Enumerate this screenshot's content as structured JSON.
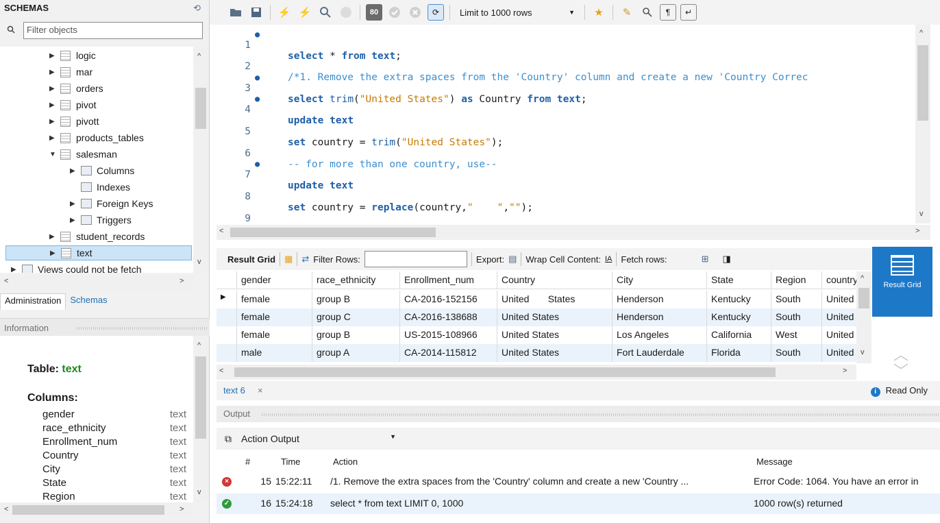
{
  "sidebar": {
    "title": "SCHEMAS",
    "filter_placeholder": "Filter objects",
    "tree": [
      {
        "label": "logic",
        "kind": "table",
        "indent": 1,
        "expanded": false
      },
      {
        "label": "mar",
        "kind": "table",
        "indent": 1,
        "expanded": false
      },
      {
        "label": "orders",
        "kind": "table",
        "indent": 1,
        "expanded": false
      },
      {
        "label": "pivot",
        "kind": "table",
        "indent": 1,
        "expanded": false
      },
      {
        "label": "pivott",
        "kind": "table",
        "indent": 1,
        "expanded": false
      },
      {
        "label": "products_tables",
        "kind": "table",
        "indent": 1,
        "expanded": false
      },
      {
        "label": "salesman",
        "kind": "table",
        "indent": 1,
        "expanded": true
      },
      {
        "label": "Columns",
        "kind": "sub",
        "indent": 2,
        "expanded": false
      },
      {
        "label": "Indexes",
        "kind": "sub",
        "indent": 2,
        "expanded": null
      },
      {
        "label": "Foreign Keys",
        "kind": "sub",
        "indent": 2,
        "expanded": false
      },
      {
        "label": "Triggers",
        "kind": "sub",
        "indent": 2,
        "expanded": false
      },
      {
        "label": "student_records",
        "kind": "table",
        "indent": 1,
        "expanded": false
      },
      {
        "label": "text",
        "kind": "table",
        "indent": 1,
        "expanded": false,
        "selected": true
      },
      {
        "label": "Views could not be fetch",
        "kind": "sub",
        "indent": 0,
        "expanded": false
      }
    ],
    "tabs": {
      "administration": "Administration",
      "schemas": "Schemas"
    },
    "info_title": "Information",
    "info": {
      "table_label": "Table:",
      "table_name": "text",
      "columns_label": "Columns:",
      "columns": [
        {
          "name": "gender",
          "type": "text"
        },
        {
          "name": "race_ethnicity",
          "type": "text"
        },
        {
          "name": "Enrollment_num",
          "type": "text"
        },
        {
          "name": "Country",
          "type": "text"
        },
        {
          "name": "City",
          "type": "text"
        },
        {
          "name": "State",
          "type": "text"
        },
        {
          "name": "Region",
          "type": "text"
        }
      ]
    }
  },
  "toolbar": {
    "limit_label": "Limit to 1000 rows"
  },
  "editor": {
    "lines": [
      {
        "n": "1",
        "dot": true
      },
      {
        "n": "2",
        "dot": false
      },
      {
        "n": "3",
        "dot": true
      },
      {
        "n": "4",
        "dot": true
      },
      {
        "n": "5",
        "dot": false
      },
      {
        "n": "6",
        "dot": false
      },
      {
        "n": "7",
        "dot": true
      },
      {
        "n": "8",
        "dot": false
      },
      {
        "n": "9",
        "dot": false
      }
    ],
    "code": {
      "l1_kw1": "select",
      "l1_t1": " * ",
      "l1_kw2": "from",
      "l1_t2": " ",
      "l1_kw3": "text",
      "l1_t3": ";",
      "l2_cmt": "/*1. Remove the extra spaces from the 'Country' column and create a new 'Country Correc",
      "l3_kw1": "select",
      "l3_t1": " ",
      "l3_fn": "trim",
      "l3_t2": "(",
      "l3_str": "\"United States\"",
      "l3_t3": ") ",
      "l3_kw2": "as",
      "l3_t4": " Country ",
      "l3_kw3": "from",
      "l3_t5": " ",
      "l3_kw4": "text",
      "l3_t6": ";",
      "l4_kw1": "update",
      "l4_t1": " ",
      "l4_kw2": "text",
      "l5_kw1": "set",
      "l5_t1": " country = ",
      "l5_fn": "trim",
      "l5_t2": "(",
      "l5_str": "\"United States\"",
      "l5_t3": ");",
      "l6_cmt": "-- for more than one country, use--",
      "l7_kw1": "update",
      "l7_t1": " ",
      "l7_kw2": "text",
      "l8_kw1": "set",
      "l8_t1": " country = ",
      "l8_fn": "replace",
      "l8_t2": "(country,",
      "l8_str1": "\"    \"",
      "l8_t3": ",",
      "l8_str2": "\"\"",
      "l8_t4": ");"
    }
  },
  "result_toolbar": {
    "result_grid": "Result Grid",
    "filter_rows": "Filter Rows:",
    "export": "Export:",
    "wrap": "Wrap Cell Content:",
    "fetch": "Fetch rows:",
    "side_label": "Result Grid"
  },
  "grid": {
    "columns": [
      "gender",
      "race_ethnicity",
      "Enrollment_num",
      "Country",
      "City",
      "State",
      "Region",
      "country"
    ],
    "rows": [
      [
        "female",
        "group B",
        "CA-2016-152156",
        "United       States",
        "Henderson",
        "Kentucky",
        "South",
        "United"
      ],
      [
        "female",
        "group C",
        "CA-2016-138688",
        "United States",
        "Henderson",
        "Kentucky",
        "South",
        "United St"
      ],
      [
        "female",
        "group B",
        "US-2015-108966",
        "United States",
        "Los Angeles",
        "California",
        "West",
        "United St"
      ],
      [
        "male",
        "group A",
        "CA-2014-115812",
        "United States",
        "Fort Lauderdale",
        "Florida",
        "South",
        "United St"
      ]
    ]
  },
  "result_tab": {
    "label": "text 6",
    "close": "×",
    "read_only": "Read Only"
  },
  "output": {
    "title": "Output",
    "selector": "Action Output",
    "headers": {
      "num": "#",
      "time": "Time",
      "action": "Action",
      "message": "Message"
    },
    "rows": [
      {
        "status": "error",
        "num": "15",
        "time": "15:22:11",
        "action": "/1. Remove the extra spaces from the 'Country' column and create a new 'Country ...",
        "message": "Error Code: 1064. You have an error in"
      },
      {
        "status": "ok",
        "num": "16",
        "time": "15:24:18",
        "action": "select * from text LIMIT 0, 1000",
        "message": "1000 row(s) returned"
      }
    ]
  },
  "colors": {
    "accent": "#1d78c8",
    "keyword": "#1f5fa8",
    "string": "#c77a00",
    "comment": "#3b8fd0",
    "selected_row": "#cce4f7",
    "table_name": "#1d8a1d"
  }
}
